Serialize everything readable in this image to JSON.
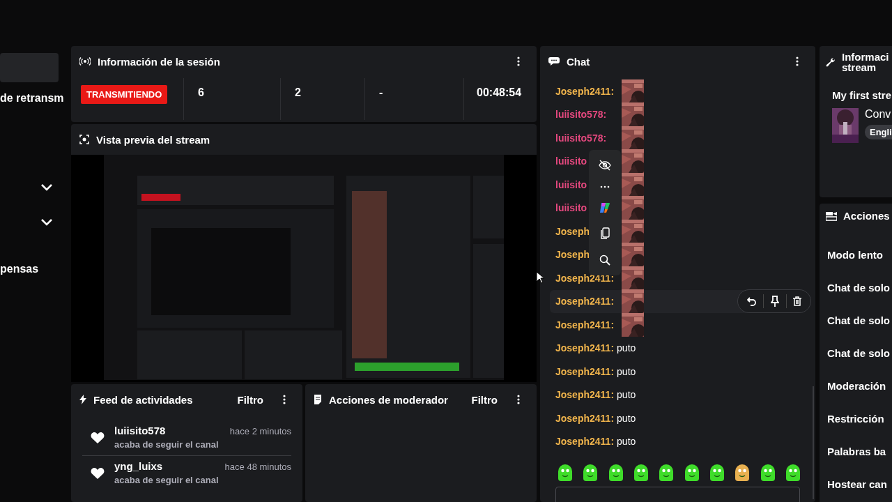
{
  "sidebar": {
    "items": [
      {
        "kind": "block"
      },
      {
        "kind": "text",
        "label": "de retransm"
      },
      {
        "kind": "chevron"
      },
      {
        "kind": "chevron"
      },
      {
        "kind": "text",
        "label": "pensas"
      }
    ]
  },
  "session": {
    "title": "Información de la sesión",
    "status": "TRANSMITIENDO",
    "stats": [
      "6",
      "2",
      "-",
      "00:48:54"
    ]
  },
  "preview": {
    "title": "Vista previa del stream"
  },
  "chat": {
    "title": "Chat",
    "messages": [
      {
        "name": "Joseph2411:",
        "color": "#f0b44c",
        "kind": "emote",
        "selected": false
      },
      {
        "name": "luiisito578:",
        "color": "#e4487e",
        "kind": "emote",
        "selected": false
      },
      {
        "name": "luiisito578:",
        "color": "#e4487e",
        "kind": "emote",
        "selected": false
      },
      {
        "name": "luiisito",
        "color": "#e4487e",
        "kind": "emote",
        "selected": false
      },
      {
        "name": "luiisito",
        "color": "#e4487e",
        "kind": "emote",
        "selected": false
      },
      {
        "name": "luiisito",
        "color": "#e4487e",
        "kind": "emote",
        "selected": false
      },
      {
        "name": "Joseph",
        "color": "#f0b44c",
        "kind": "emote",
        "selected": false
      },
      {
        "name": "Joseph",
        "color": "#f0b44c",
        "kind": "emote",
        "selected": false
      },
      {
        "name": "Joseph2411:",
        "color": "#f0b44c",
        "kind": "emote",
        "selected": false
      },
      {
        "name": "Joseph2411:",
        "color": "#f0b44c",
        "kind": "emote",
        "selected": true
      },
      {
        "name": "Joseph2411:",
        "color": "#f0b44c",
        "kind": "emote",
        "selected": false
      },
      {
        "name": "Joseph2411:",
        "color": "#f0b44c",
        "kind": "text",
        "text": "puto",
        "selected": false
      },
      {
        "name": "Joseph2411:",
        "color": "#f0b44c",
        "kind": "text",
        "text": "puto",
        "selected": false
      },
      {
        "name": "Joseph2411:",
        "color": "#f0b44c",
        "kind": "text",
        "text": "puto",
        "selected": false
      },
      {
        "name": "Joseph2411:",
        "color": "#f0b44c",
        "kind": "text",
        "text": "puto",
        "selected": false
      },
      {
        "name": "Joseph2411:",
        "color": "#f0b44c",
        "kind": "text",
        "text": "puto",
        "selected": false
      }
    ]
  },
  "feed": {
    "title": "Feed de actividades",
    "filter": "Filtro",
    "items": [
      {
        "user": "luiisito578",
        "time": "hace 2 minutos",
        "action": "acaba de seguir el canal"
      },
      {
        "user": "yng_luixs",
        "time": "hace 48 minutos",
        "action": "acaba de seguir el canal"
      }
    ]
  },
  "mod_actions": {
    "title": "Acciones de moderador",
    "filter": "Filtro"
  },
  "stream_info": {
    "title": "Informaci stream",
    "stream_title": "My first stre",
    "category": "Conv",
    "tag": "Engli"
  },
  "actions": {
    "title": "Acciones",
    "items": [
      "Modo lento",
      "Chat de solo",
      "Chat de solo",
      "Chat de solo",
      "Moderación",
      "Restricción",
      "Palabras ba",
      "Hostear can"
    ]
  }
}
